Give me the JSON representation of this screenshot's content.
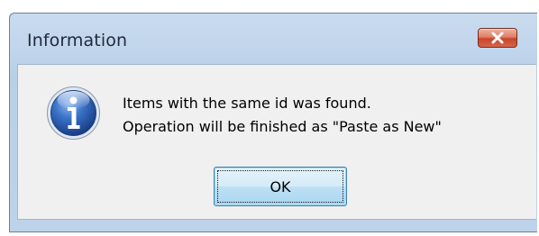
{
  "dialog": {
    "title": "Information",
    "close_icon": "close-icon",
    "icon": "information-icon",
    "message_lines": [
      "Items with the same id was found.",
      "Operation will be finished as \"Paste as New\""
    ],
    "ok_label": "OK"
  },
  "colors": {
    "close_button": "#d6654a",
    "info_icon_blue": "#2a5fb5",
    "ok_button_border": "#3c7fb1"
  }
}
